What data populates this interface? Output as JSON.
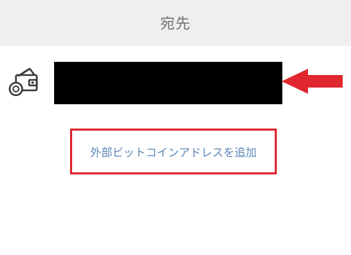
{
  "header": {
    "title": "宛先"
  },
  "wallet": {
    "icon": "wallet-icon"
  },
  "add_address": {
    "label": "外部ビットコインアドレスを追加"
  },
  "colors": {
    "header_bg": "#efefef",
    "highlight_red": "#e0262e",
    "link_blue": "#5b86b6"
  }
}
